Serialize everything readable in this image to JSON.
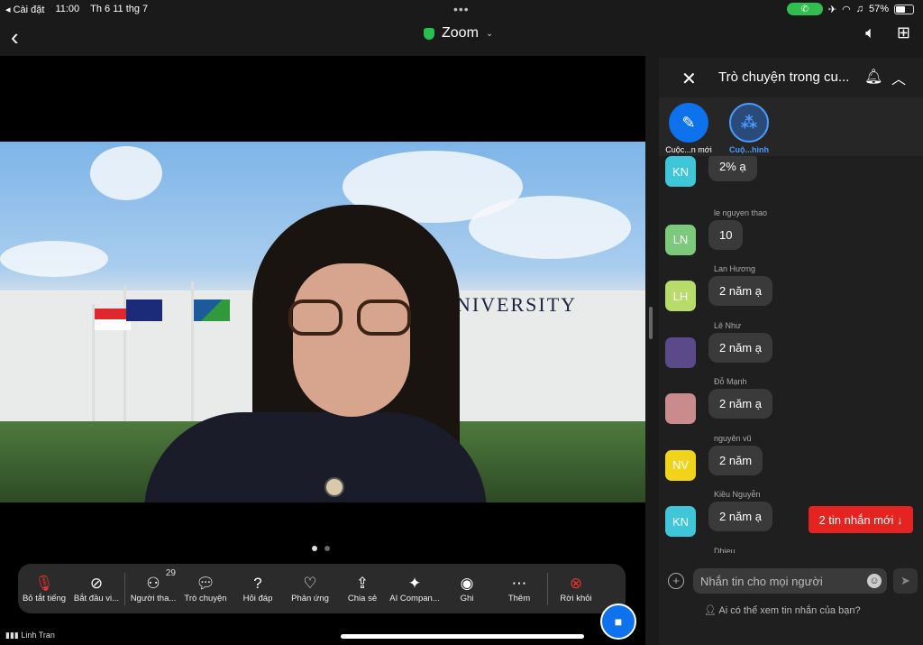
{
  "status_bar": {
    "back_app": "◂ Cài đặt",
    "time": "11:00",
    "date": "Th 6 11 thg 7",
    "battery": "57%",
    "battery_level": 0.57
  },
  "header": {
    "app_title": "Zoom"
  },
  "toolbar": {
    "items": [
      {
        "label": "Bỏ tắt tiếng",
        "icon": "mic-off-icon"
      },
      {
        "label": "Bắt đầu vi...",
        "icon": "video-off-icon"
      },
      {
        "label": "Người tha...",
        "icon": "participants-icon",
        "badge": "29"
      },
      {
        "label": "Trò chuyện",
        "icon": "chat-icon"
      },
      {
        "label": "Hỏi đáp",
        "icon": "qa-icon"
      },
      {
        "label": "Phản ứng",
        "icon": "heart-icon"
      },
      {
        "label": "Chia sẻ",
        "icon": "share-icon"
      },
      {
        "label": "AI Compan...",
        "icon": "sparkle-icon"
      },
      {
        "label": "Ghi",
        "icon": "record-icon"
      },
      {
        "label": "Thêm",
        "icon": "more-icon"
      },
      {
        "label": "Rời khỏi",
        "icon": "leave-icon"
      }
    ]
  },
  "self_view": {
    "name": "Linh Tran"
  },
  "video": {
    "banner_text": "J    UNIVERSITY"
  },
  "chat": {
    "title": "Trò chuyện trong cu...",
    "tabs": [
      {
        "label": "Cuộc...n mới",
        "icon": "compose-icon"
      },
      {
        "label": "Cuộ...hình",
        "icon": "group-icon"
      }
    ],
    "messages": [
      {
        "sender": "",
        "initials": "KN",
        "color": "#3fc7d9",
        "text": "2% ạ"
      },
      {
        "sender": "le nguyen thao",
        "initials": "LN",
        "color": "#7dc97b",
        "text": "10"
      },
      {
        "sender": "Lan Hương",
        "initials": "LH",
        "color": "#b7dc6a",
        "text": "2 năm ạ"
      },
      {
        "sender": "Lê Như",
        "initials": "",
        "color": "#5a4a8a",
        "text": "2 năm ạ"
      },
      {
        "sender": "Đỗ Mạnh",
        "initials": "",
        "color": "#c98b8b",
        "text": "2 năm ạ"
      },
      {
        "sender": "nguyên vũ",
        "initials": "NV",
        "color": "#f2d31b",
        "text": "2 năm"
      },
      {
        "sender": "Kiều Nguyễn",
        "initials": "KN",
        "color": "#3fc7d9",
        "text": "2 năm ạ"
      },
      {
        "sender": "Dhieu",
        "initials": "",
        "color": "#f2d31b",
        "text": ""
      }
    ],
    "new_messages_label": "2 tin nhắn mới ↓",
    "input_placeholder": "Nhắn tin cho mọi người",
    "visibility_note": "Ai có thể xem tin nhắn của bạn?"
  }
}
